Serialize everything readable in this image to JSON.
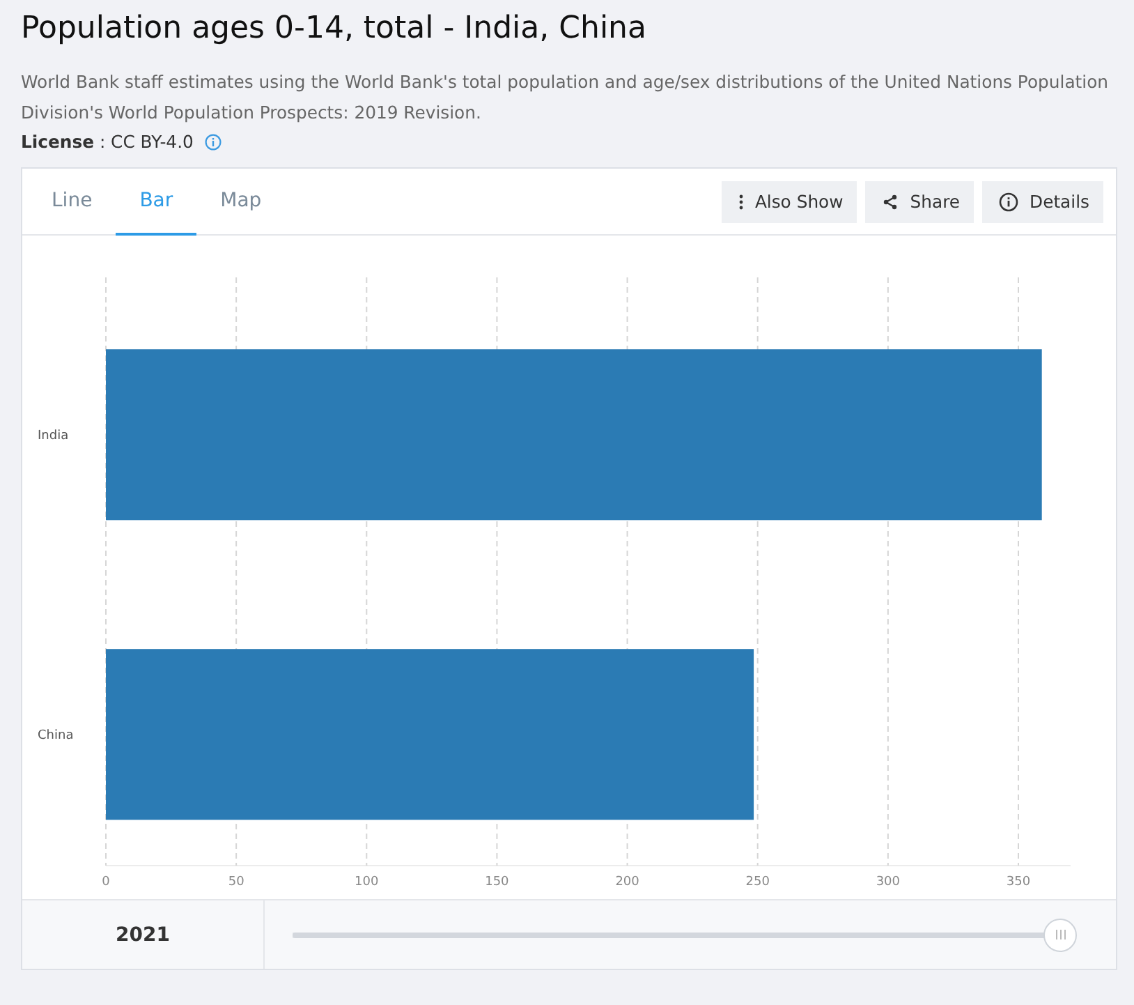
{
  "title": "Population ages 0-14, total - India, China",
  "description": "World Bank staff estimates using the World Bank's total population and age/sex distributions of the United Nations Population Division's World Population Prospects: 2019 Revision.",
  "license": {
    "label": "License",
    "value": ": CC BY-4.0"
  },
  "tabs": [
    {
      "label": "Line",
      "selected": false
    },
    {
      "label": "Bar",
      "selected": true
    },
    {
      "label": "Map",
      "selected": false
    }
  ],
  "actions": [
    {
      "kind": "more",
      "label": "Also Show"
    },
    {
      "kind": "share",
      "label": "Share"
    },
    {
      "kind": "info",
      "label": "Details"
    }
  ],
  "chart_data": {
    "type": "bar",
    "orientation": "horizontal",
    "categories": [
      "India",
      "China"
    ],
    "series": [
      {
        "color": "#2b7bb4",
        "values": [
          359,
          248.5
        ]
      }
    ],
    "xlim": [
      0,
      370
    ],
    "grid": true,
    "xticks": [
      0,
      50,
      100,
      150,
      200,
      250,
      300,
      350
    ]
  },
  "timeline": {
    "year": "2021",
    "level": 1
  }
}
